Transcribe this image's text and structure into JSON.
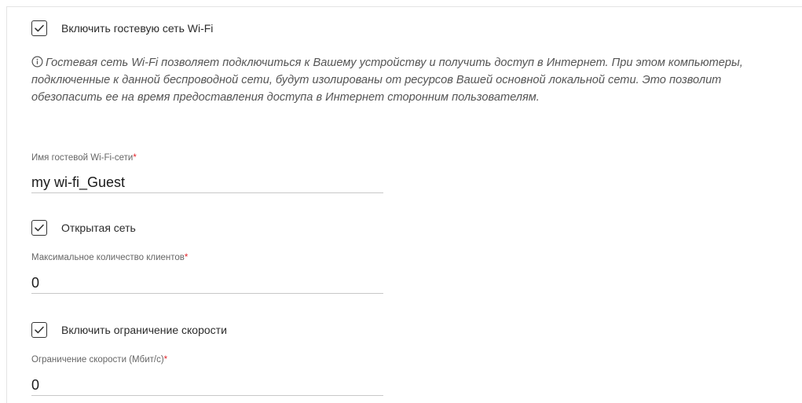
{
  "guest_wifi": {
    "enable_label": "Включить гостевую сеть Wi-Fi",
    "enable_checked": true,
    "info_text": "Гостевая сеть Wi-Fi позволяет подключиться к Вашему устройству и получить доступ в Интернет. При этом компьютеры, подключенные к данной беспроводной сети, будут изолированы от ресурсов Вашей основной локальной сети. Это позволит обезопасить ее на время предоставления доступа в Интернет сторонним пользователям."
  },
  "ssid_field": {
    "label": "Имя гостевой Wi-Fi-сети",
    "required_mark": "*",
    "value": "my wi-fi_Guest"
  },
  "open_network": {
    "label": "Открытая сеть",
    "checked": true
  },
  "max_clients_field": {
    "label": "Максимальное количество клиентов",
    "required_mark": "*",
    "value": "0"
  },
  "speed_limit": {
    "label": "Включить ограничение скорости",
    "checked": true
  },
  "speed_limit_field": {
    "label": "Ограничение скорости (Мбит/с)",
    "required_mark": "*",
    "value": "0"
  },
  "icons": {
    "checkbox_check": "check-icon",
    "info": "info-circle-icon"
  },
  "colors": {
    "required": "#e3262c",
    "text": "#2b2b2b",
    "info_text": "#555555",
    "underline": "#c8c8c8"
  }
}
